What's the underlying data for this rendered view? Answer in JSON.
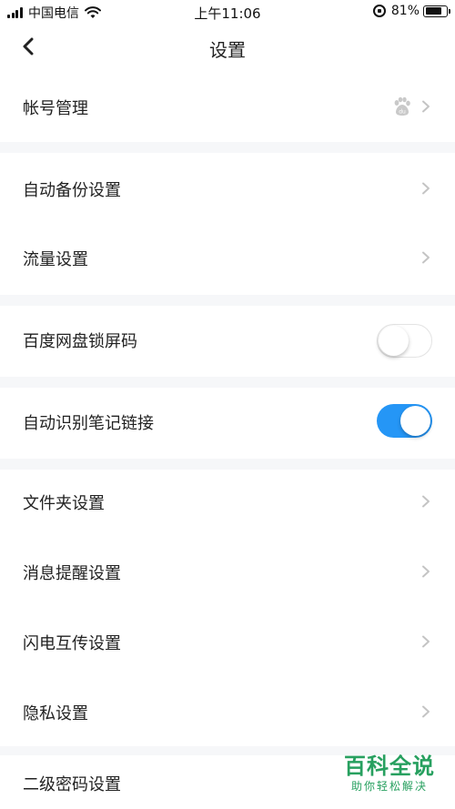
{
  "status_bar": {
    "carrier": "中国电信",
    "time": "上午11:06",
    "battery_percent": "81%",
    "battery_level": 0.81
  },
  "nav": {
    "title": "设置",
    "back_icon": "chevron-left-icon"
  },
  "settings": {
    "account": {
      "label": "帐号管理",
      "icon": "baidu-paw-icon"
    },
    "auto_backup": {
      "label": "自动备份设置"
    },
    "traffic": {
      "label": "流量设置"
    },
    "lock_screen": {
      "label": "百度网盘锁屏码",
      "enabled": false
    },
    "note_links": {
      "label": "自动识别笔记链接",
      "enabled": true
    },
    "folder": {
      "label": "文件夹设置"
    },
    "notification": {
      "label": "消息提醒设置"
    },
    "flash_transfer": {
      "label": "闪电互传设置"
    },
    "privacy": {
      "label": "隐私设置"
    },
    "secondary_password": {
      "label": "二级密码设置"
    }
  },
  "colors": {
    "toggle_on": "#2596f6",
    "separator": "#f6f7f9",
    "watermark": "#27a05f"
  },
  "watermark": {
    "title": "百科全说",
    "subtitle": "助你轻松解决"
  }
}
